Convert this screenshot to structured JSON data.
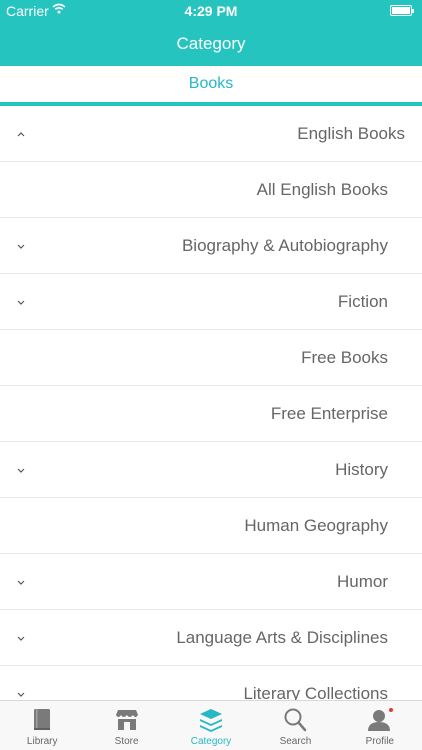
{
  "status_bar": {
    "carrier": "Carrier",
    "time": "4:29 PM"
  },
  "nav": {
    "title": "Category"
  },
  "segment": {
    "label": "Books"
  },
  "categories": [
    {
      "label": "English Books",
      "chevron": "up"
    },
    {
      "label": "All English Books",
      "chevron": ""
    },
    {
      "label": "Biography & Autobiography",
      "chevron": "down"
    },
    {
      "label": "Fiction",
      "chevron": "down"
    },
    {
      "label": "Free Books",
      "chevron": ""
    },
    {
      "label": "Free Enterprise",
      "chevron": ""
    },
    {
      "label": "History",
      "chevron": "down"
    },
    {
      "label": "Human Geography",
      "chevron": ""
    },
    {
      "label": "Humor",
      "chevron": "down"
    },
    {
      "label": "Language Arts & Disciplines",
      "chevron": "down"
    },
    {
      "label": "Literary Collections",
      "chevron": "down"
    }
  ],
  "tabs": [
    {
      "label": "Library",
      "icon": "book-icon",
      "active": false
    },
    {
      "label": "Store",
      "icon": "store-icon",
      "active": false
    },
    {
      "label": "Category",
      "icon": "layers-icon",
      "active": true
    },
    {
      "label": "Search",
      "icon": "search-icon",
      "active": false
    },
    {
      "label": "Profile",
      "icon": "profile-icon",
      "active": false,
      "badge": true
    }
  ],
  "colors": {
    "accent": "#26c4bf",
    "badge": "#e53935"
  }
}
